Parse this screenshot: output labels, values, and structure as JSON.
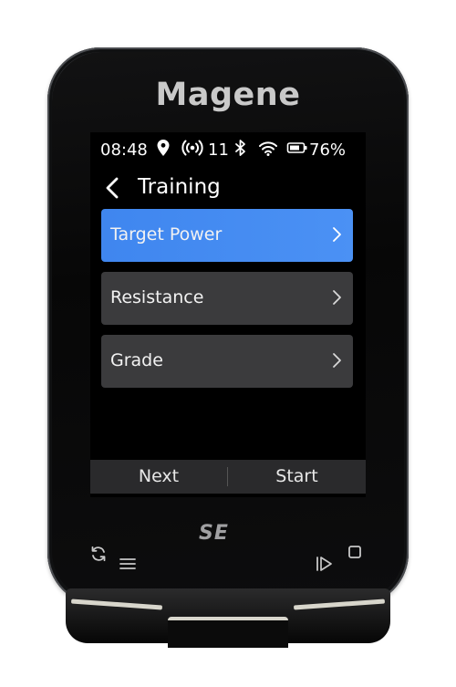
{
  "device": {
    "brand": "Magene",
    "model_badge": "SE"
  },
  "status_bar": {
    "time": "08:48",
    "sensor_count": "11",
    "battery": "76%"
  },
  "screen": {
    "title": "Training",
    "menu": [
      {
        "label": "Target Power",
        "selected": true
      },
      {
        "label": "Resistance",
        "selected": false
      },
      {
        "label": "Grade",
        "selected": false
      }
    ],
    "softkeys": {
      "left": "Next",
      "right": "Start"
    }
  },
  "colors": {
    "selected_item": "#4a8ff2",
    "item_bg": "#3b3b3d",
    "softbar_bg": "#2a2a2c",
    "screen_bg": "#000000"
  },
  "icons": [
    "location-icon",
    "sensor-signal-icon",
    "bluetooth-icon",
    "wifi-icon",
    "battery-icon",
    "back-chevron-icon",
    "chevron-right-icon",
    "sync-icon",
    "menu-icon",
    "play-pause-icon",
    "stop-icon"
  ]
}
